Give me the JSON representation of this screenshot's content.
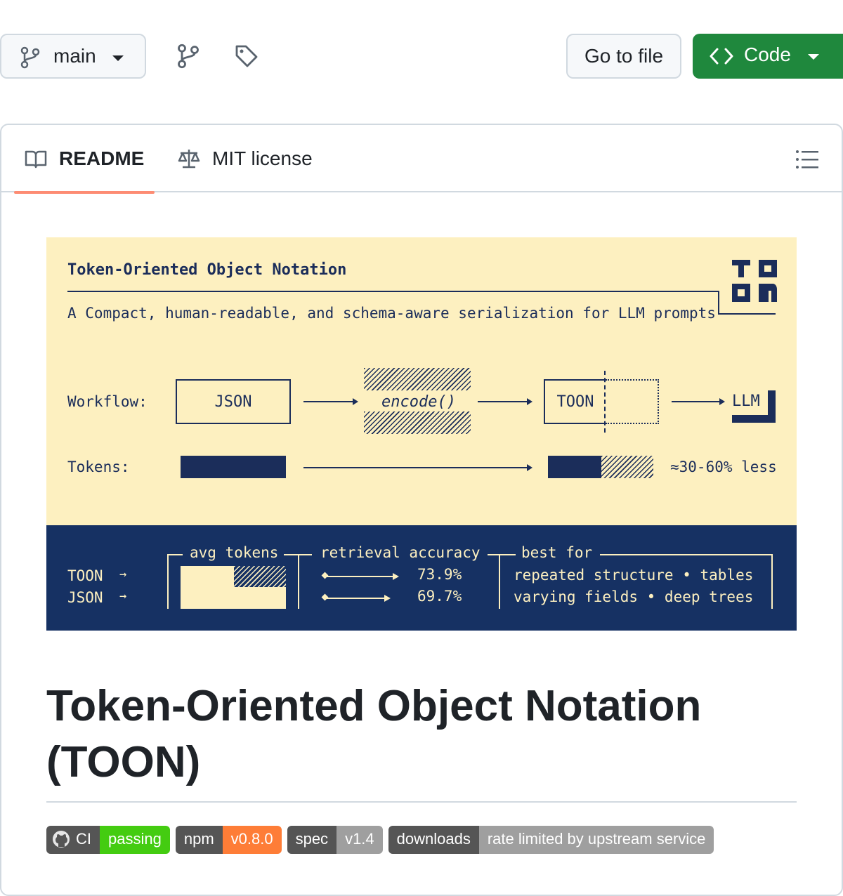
{
  "toolbar": {
    "branch_label": "main",
    "go_to_file_label": "Go to file",
    "code_label": "Code"
  },
  "readme_tabs": {
    "readme_label": "README",
    "license_label": "MIT license"
  },
  "banner": {
    "title": "Token-Oriented Object Notation",
    "subtitle": "A Compact, human-readable, and schema-aware serialization for LLM prompts",
    "workflow_label": "Workflow:",
    "json_box": "JSON",
    "encode_label": "encode()",
    "toon_box": "TOON",
    "llm_label": "LLM",
    "tokens_label": "Tokens:",
    "savings_label": "≈30-60% less",
    "rows": [
      {
        "name": "TOON",
        "arrow": "→",
        "accuracy": "73.9%"
      },
      {
        "name": "JSON",
        "arrow": "→",
        "accuracy": "69.7%"
      }
    ],
    "avg_tokens_label": "avg tokens",
    "retrieval_label": "retrieval accuracy",
    "best_for_label": "best for",
    "best_line_1": "repeated structure • tables",
    "best_line_2": "varying fields • deep trees"
  },
  "heading": {
    "line1": "Token-Oriented Object Notation",
    "line2": "(TOON)"
  },
  "badges": [
    {
      "left": "CI",
      "right": "passing",
      "color": "#4c1"
    },
    {
      "left": "npm",
      "right": "v0.8.0",
      "color": "#fe7d37"
    },
    {
      "left": "spec",
      "right": "v1.4",
      "color": "#9f9f9f"
    },
    {
      "left": "downloads",
      "right": "rate limited by upstream service",
      "color": "#9f9f9f"
    }
  ],
  "colors": {
    "code_button": "#1f883d",
    "tab_underline": "#fd8c73",
    "banner_light": "#fdf0c0",
    "banner_dark": "#163163"
  }
}
